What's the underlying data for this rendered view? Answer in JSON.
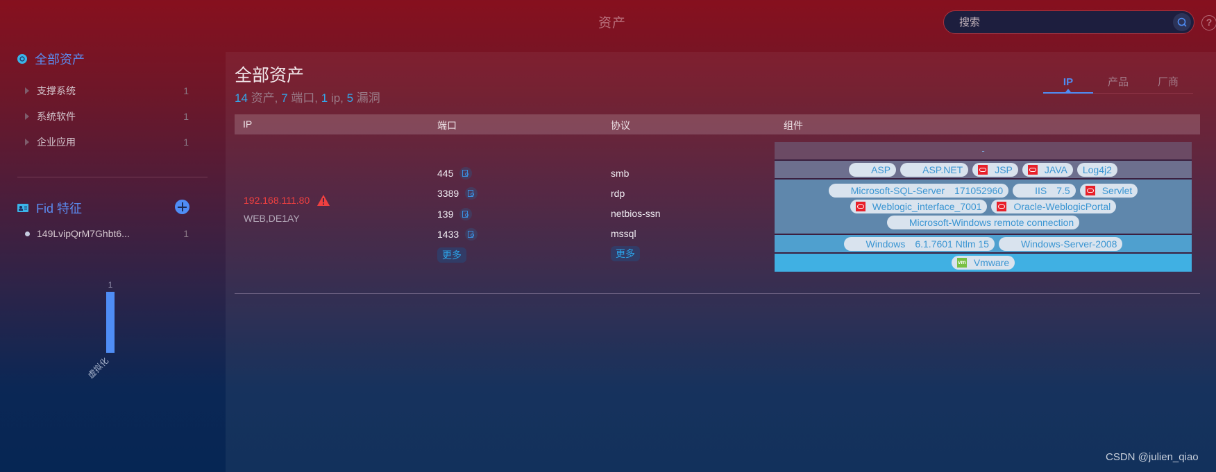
{
  "header": {
    "title": "资产",
    "search_placeholder": "搜索",
    "search_icon": "search-icon",
    "help_label": "?"
  },
  "sidebar": {
    "all_assets": {
      "label": "全部资产",
      "icon": "asset-pie-icon"
    },
    "categories": [
      {
        "label": "支撑系统",
        "count": "1"
      },
      {
        "label": "系统软件",
        "count": "1"
      },
      {
        "label": "企业应用",
        "count": "1"
      }
    ],
    "fid": {
      "label": "Fid 特征",
      "icon": "id-card-icon",
      "add_icon": "plus-circle-icon",
      "items": [
        {
          "label": "149LvipQrM7Ghbt6...",
          "count": "1"
        }
      ]
    }
  },
  "chart_data": {
    "type": "bar",
    "categories": [
      "虚拟化"
    ],
    "values": [
      1
    ],
    "title": "",
    "xlabel": "",
    "ylabel": "",
    "ylim": [
      0,
      1
    ],
    "data_labels": [
      "1"
    ],
    "color": "#4f8df5"
  },
  "main": {
    "title": "全部资产",
    "summary": {
      "assets_num": "14",
      "assets_label": " 资产, ",
      "ports_num": "7",
      "ports_label": " 端口, ",
      "ip_num": "1",
      "ip_label": " ip, ",
      "vulns_num": "5",
      "vulns_label": " 漏洞"
    },
    "tabs": [
      {
        "label": "IP",
        "active": true
      },
      {
        "label": "产品",
        "active": false
      },
      {
        "label": "厂商",
        "active": false
      }
    ],
    "columns": [
      "IP",
      "端口",
      "协议",
      "组件"
    ],
    "row": {
      "ip": "192.168.111.80",
      "ip_color": "#f04040",
      "hostnames": "WEB,DE1AY",
      "ports": [
        "445",
        "3389",
        "139",
        "1433"
      ],
      "protocols": [
        "smb",
        "rdp",
        "netbios-ssn",
        "mssql"
      ],
      "more_label": "更多",
      "components": {
        "layer0": "-",
        "layer1": [
          {
            "name": "ASP",
            "icon": "microsoft"
          },
          {
            "name": "ASP.NET",
            "icon": "microsoft"
          },
          {
            "name": "JSP",
            "icon": "oracle"
          },
          {
            "name": "JAVA",
            "icon": "oracle"
          },
          {
            "name": "Log4j2",
            "icon": ""
          }
        ],
        "layer2": [
          {
            "name": "Microsoft-SQL-Server",
            "version": "171052960",
            "icon": "microsoft"
          },
          {
            "name": "IIS",
            "version": "7.5",
            "icon": "microsoft"
          },
          {
            "name": "Servlet",
            "icon": "oracle"
          },
          {
            "name": "Weblogic_interface_7001",
            "icon": "oracle"
          },
          {
            "name": "Oracle-WeblogicPortal",
            "icon": "oracle"
          },
          {
            "name": "Microsoft-Windows remote connection",
            "icon": "microsoft"
          }
        ],
        "layer3": [
          {
            "name": "Windows",
            "version": "6.1.7601 Ntlm 15",
            "icon": "microsoft"
          },
          {
            "name": "Windows-Server-2008",
            "icon": "microsoft"
          }
        ],
        "layer4": [
          {
            "name": "Vmware",
            "icon": "vmware"
          }
        ]
      }
    }
  },
  "watermark": "CSDN @julien_qiao"
}
